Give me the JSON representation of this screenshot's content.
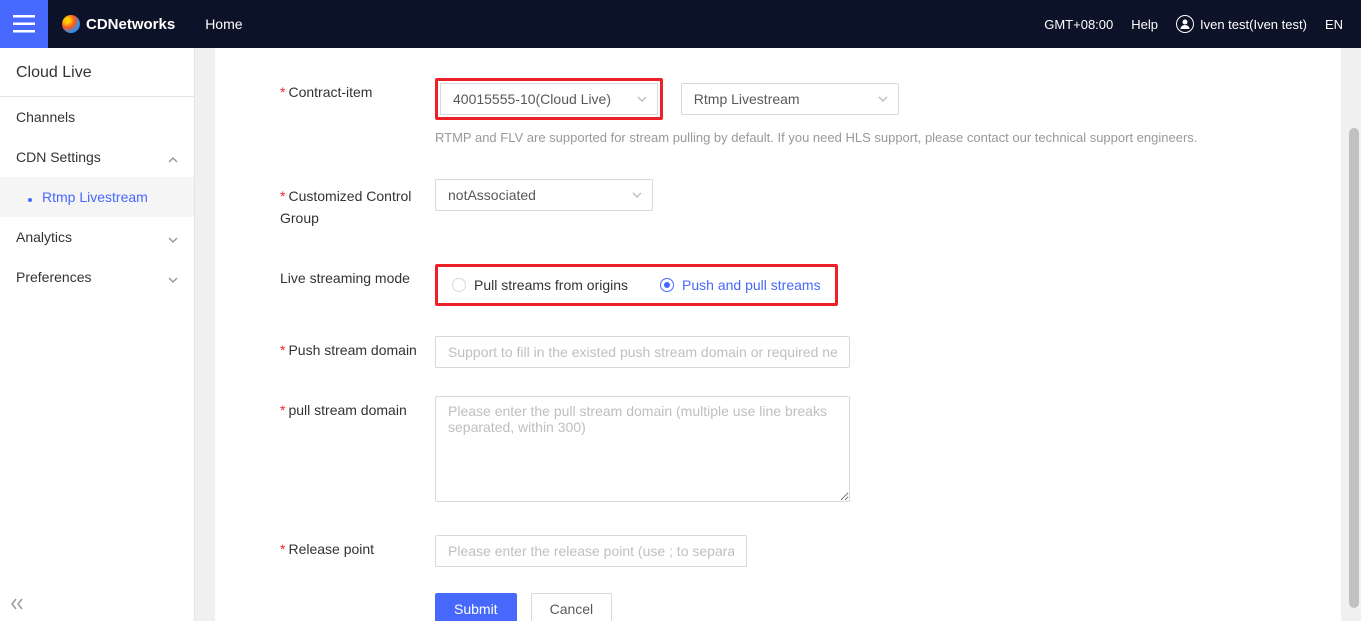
{
  "topbar": {
    "brand": "CDNetworks",
    "home": "Home",
    "timezone": "GMT+08:00",
    "help": "Help",
    "user": "Iven test(Iven test)",
    "lang": "EN"
  },
  "sidebar": {
    "title": "Cloud Live",
    "items": {
      "channels": "Channels",
      "cdn_settings": "CDN Settings",
      "rtmp": "Rtmp Livestream",
      "analytics": "Analytics",
      "preferences": "Preferences"
    }
  },
  "form": {
    "contract_item": {
      "label": "Contract-item",
      "value": "40015555-10(Cloud Live)",
      "type_value": "Rtmp Livestream",
      "help": "RTMP and FLV are supported for stream pulling by default. If you need HLS support, please contact our technical support engineers."
    },
    "ccg": {
      "label": "Customized Control Group",
      "value": "notAssociated"
    },
    "mode": {
      "label": "Live streaming mode",
      "opt1": "Pull streams from origins",
      "opt2": "Push and pull streams"
    },
    "push_domain": {
      "label": "Push stream domain",
      "placeholder": "Support to fill in the existed push stream domain or required new-created domain"
    },
    "pull_domain": {
      "label": "pull stream domain",
      "placeholder": "Please enter the pull stream domain (multiple use line breaks separated, within 300)"
    },
    "release_point": {
      "label": "Release point",
      "placeholder": "Please enter the release point (use ; to separate different release points)"
    },
    "submit": "Submit",
    "cancel": "Cancel"
  }
}
